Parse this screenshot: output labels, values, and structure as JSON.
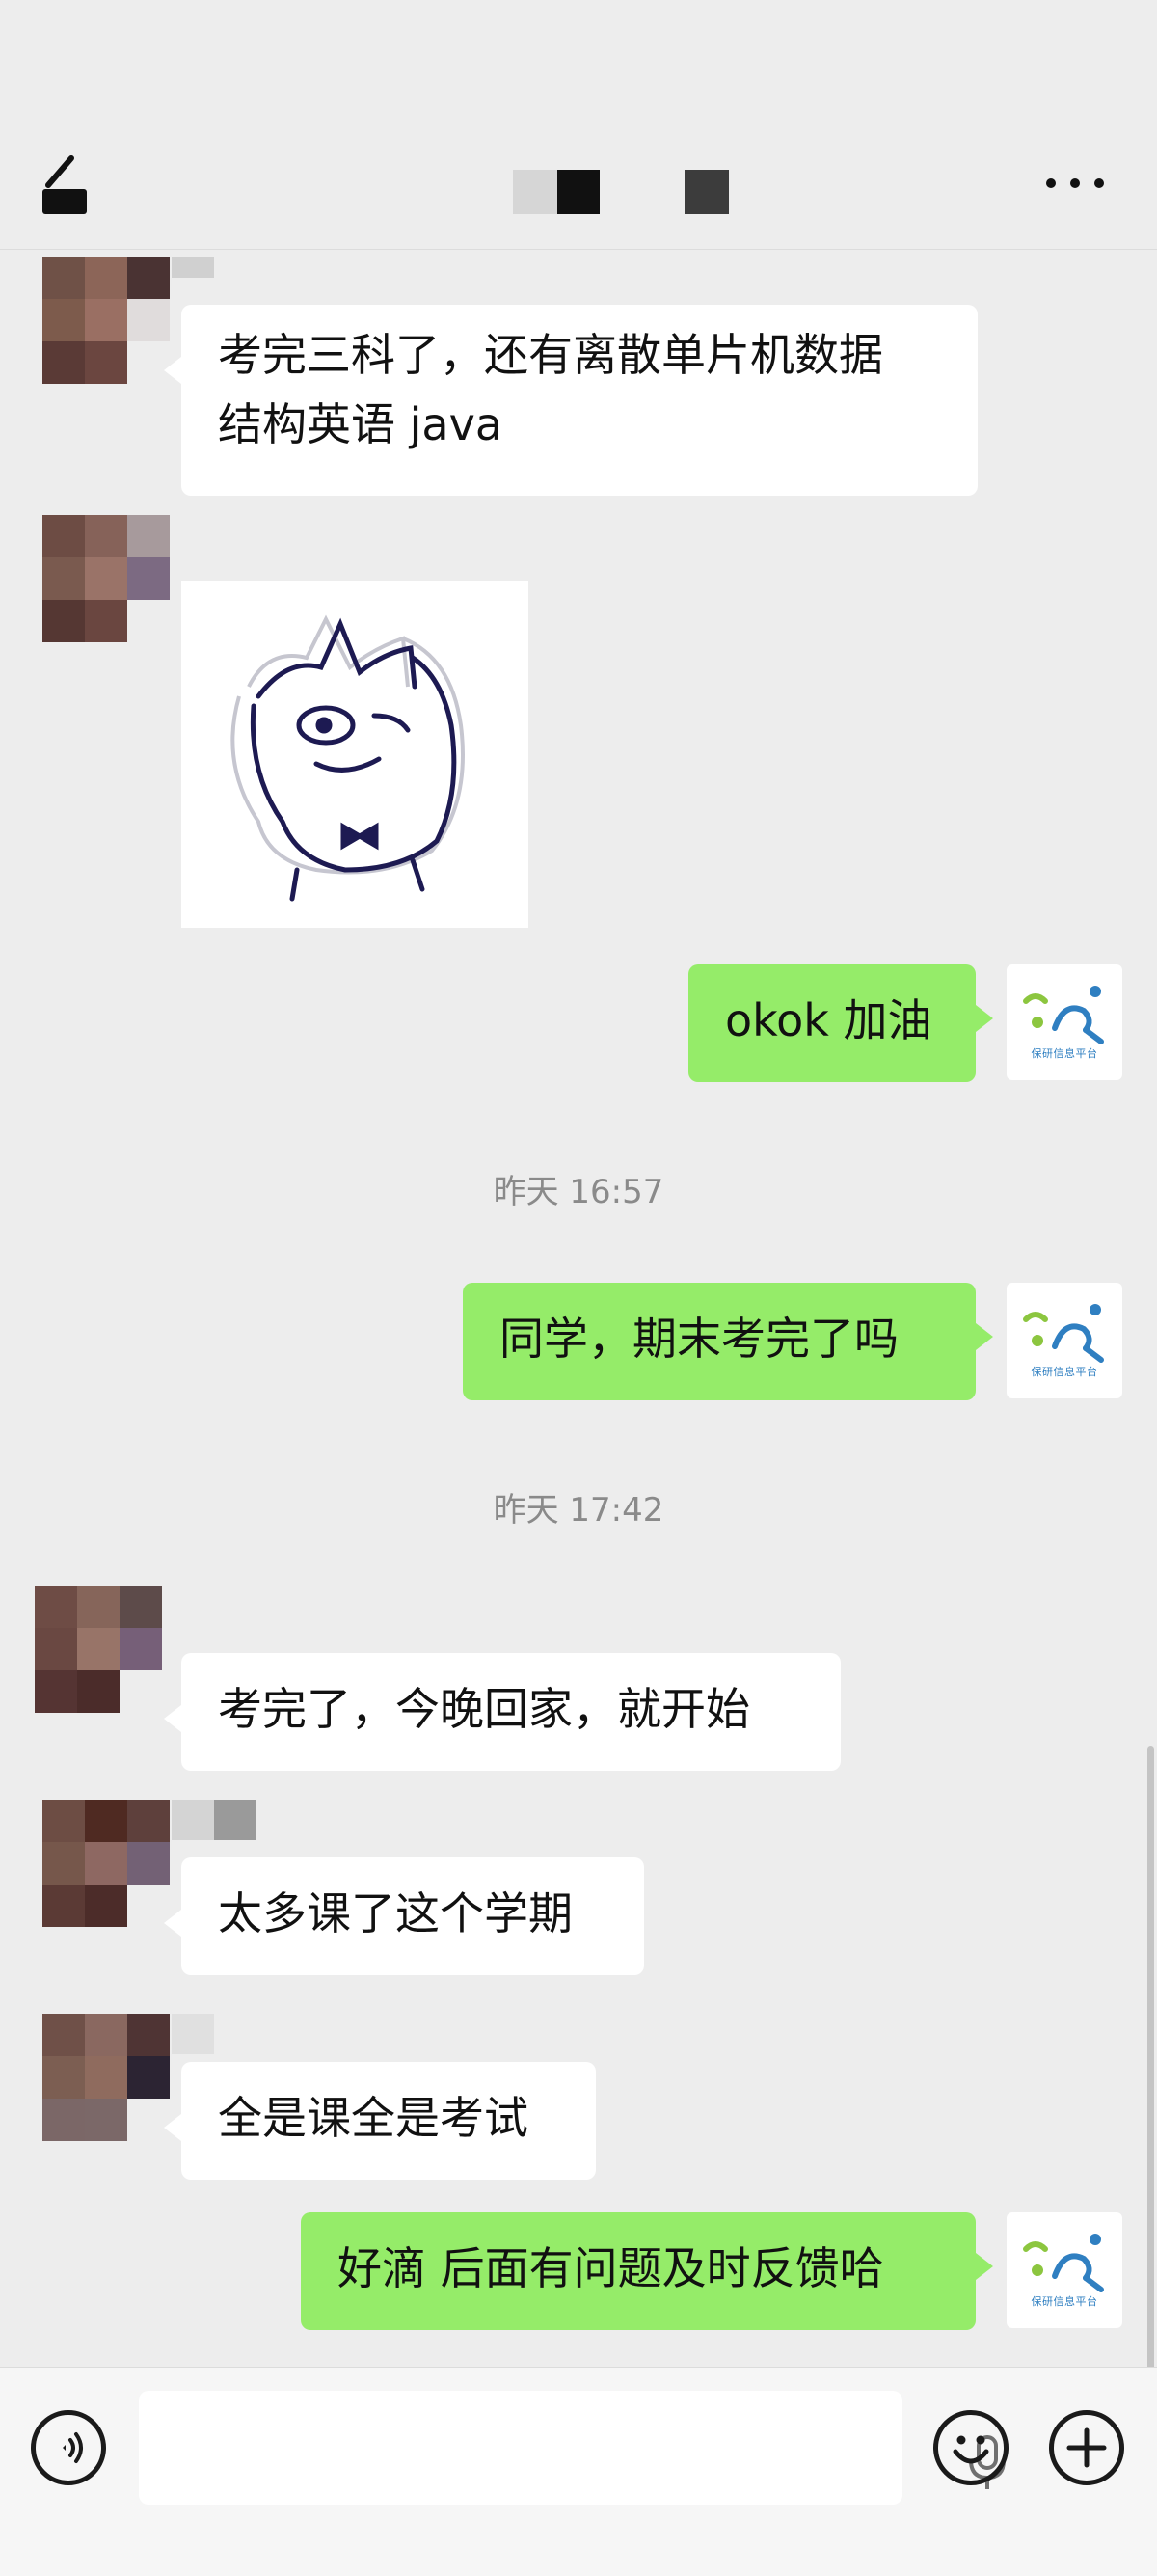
{
  "header": {
    "back_icon": "back-arrow-icon",
    "more_icon": "more-horizontal-icon",
    "title_redacted": true
  },
  "messages": [
    {
      "id": 1,
      "side": "in",
      "type": "text",
      "line1": "考完三科了，还有离散单片机数据",
      "line2": "结构英语 java"
    },
    {
      "id": 2,
      "side": "in",
      "type": "sticker",
      "sticker": "cartoon-cat-sticker"
    },
    {
      "id": 3,
      "side": "out",
      "type": "text",
      "text": "okok 加油"
    },
    {
      "id": 4,
      "type": "timestamp",
      "text": "昨天 16:57"
    },
    {
      "id": 5,
      "side": "out",
      "type": "text",
      "text": "同学，期末考完了吗"
    },
    {
      "id": 6,
      "type": "timestamp",
      "text": "昨天 17:42"
    },
    {
      "id": 7,
      "side": "in",
      "type": "text",
      "text": "考完了，今晚回家，就开始"
    },
    {
      "id": 8,
      "side": "in",
      "type": "text",
      "text": "太多课了这个学期"
    },
    {
      "id": 9,
      "side": "in",
      "type": "text",
      "text": "全是课全是考试"
    },
    {
      "id": 10,
      "side": "out",
      "type": "text",
      "text": "好滴 后面有问题及时反馈哈"
    }
  ],
  "self_avatar": {
    "logo_text": "保研信息平台"
  },
  "input_bar": {
    "voice_icon": "voice-icon",
    "mic_icon": "microphone-icon",
    "emoji_icon": "emoji-icon",
    "plus_icon": "plus-icon",
    "message_value": ""
  },
  "colors": {
    "background": "#ededed",
    "incoming_bubble": "#ffffff",
    "outgoing_bubble": "#95ec69",
    "logo_blue": "#2f7fc1",
    "logo_green": "#8cc63f"
  }
}
